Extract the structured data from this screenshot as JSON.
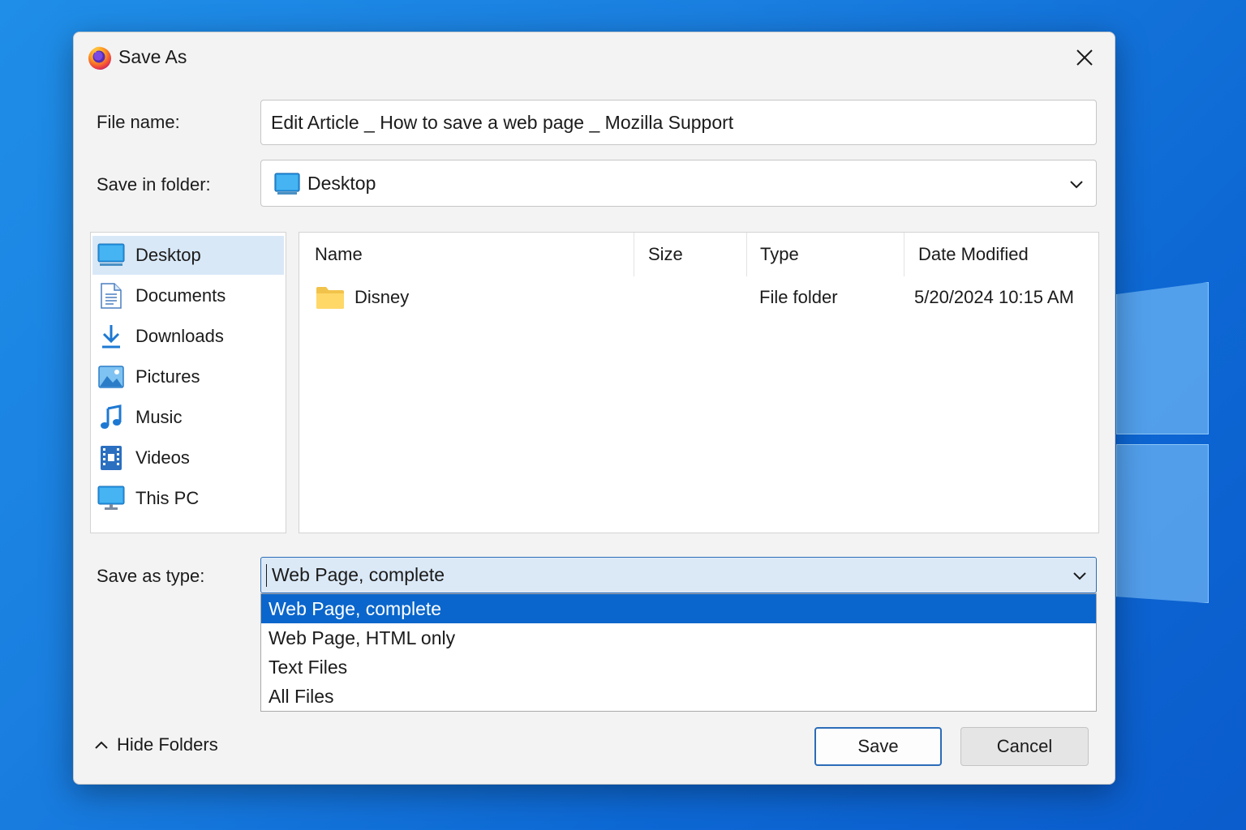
{
  "window": {
    "title": "Save As",
    "app_icon": "firefox-icon",
    "close_icon": "close-icon"
  },
  "form": {
    "file_name_label": "File name:",
    "file_name_value": "Edit Article _ How to save a web page _ Mozilla Support",
    "save_in_label": "Save in folder:",
    "save_in_value": "Desktop",
    "save_in_icon": "desktop-icon",
    "save_type_label": "Save as type:",
    "save_type_value": "Web Page, complete"
  },
  "sidebar": {
    "items": [
      {
        "label": "Desktop",
        "icon": "desktop-icon",
        "selected": true
      },
      {
        "label": "Documents",
        "icon": "document-icon"
      },
      {
        "label": "Downloads",
        "icon": "download-icon"
      },
      {
        "label": "Pictures",
        "icon": "pictures-icon"
      },
      {
        "label": "Music",
        "icon": "music-icon"
      },
      {
        "label": "Videos",
        "icon": "video-icon"
      },
      {
        "label": "This PC",
        "icon": "computer-icon"
      }
    ]
  },
  "file_list": {
    "columns": [
      "Name",
      "Size",
      "Type",
      "Date Modified"
    ],
    "rows": [
      {
        "name": "Disney",
        "size": "",
        "type": "File folder",
        "date_modified": "5/20/2024 10:15 AM",
        "icon": "folder-icon"
      }
    ]
  },
  "type_options": [
    "Web Page, complete",
    "Web Page, HTML only",
    "Text Files",
    "All Files"
  ],
  "footer": {
    "hide_folders_label": "Hide Folders",
    "save_label": "Save",
    "cancel_label": "Cancel"
  },
  "colors": {
    "accent": "#0a66cc",
    "selection": "#d9e8f7",
    "background": "#1a7fe0"
  }
}
